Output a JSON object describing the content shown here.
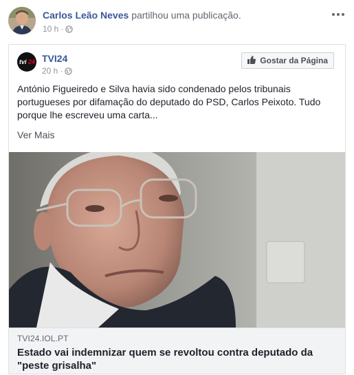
{
  "outer_post": {
    "author": "Carlos Leão Neves",
    "action": "partilhou uma publicação.",
    "time": "10 h",
    "privacy_icon": "globe-icon",
    "more_icon": "more-dots-icon"
  },
  "shared_post": {
    "page_name": "TVI24",
    "time": "20 h",
    "privacy_icon": "globe-icon",
    "like_page_button": "Gostar da Página",
    "like_icon": "thumbs-up-icon",
    "text": "António Figueiredo e Silva havia sido condenado pelos tribunais portugueses por difamação do deputado do PSD, Carlos Peixoto. Tudo porque lhe escreveu uma carta...",
    "see_more": "Ver Mais"
  },
  "link_preview": {
    "domain": "TVI24.IOL.PT",
    "title": "Estado vai indemnizar quem se revoltou contra deputado da \"peste grisalha\""
  },
  "logo": {
    "text": "tvi24"
  }
}
